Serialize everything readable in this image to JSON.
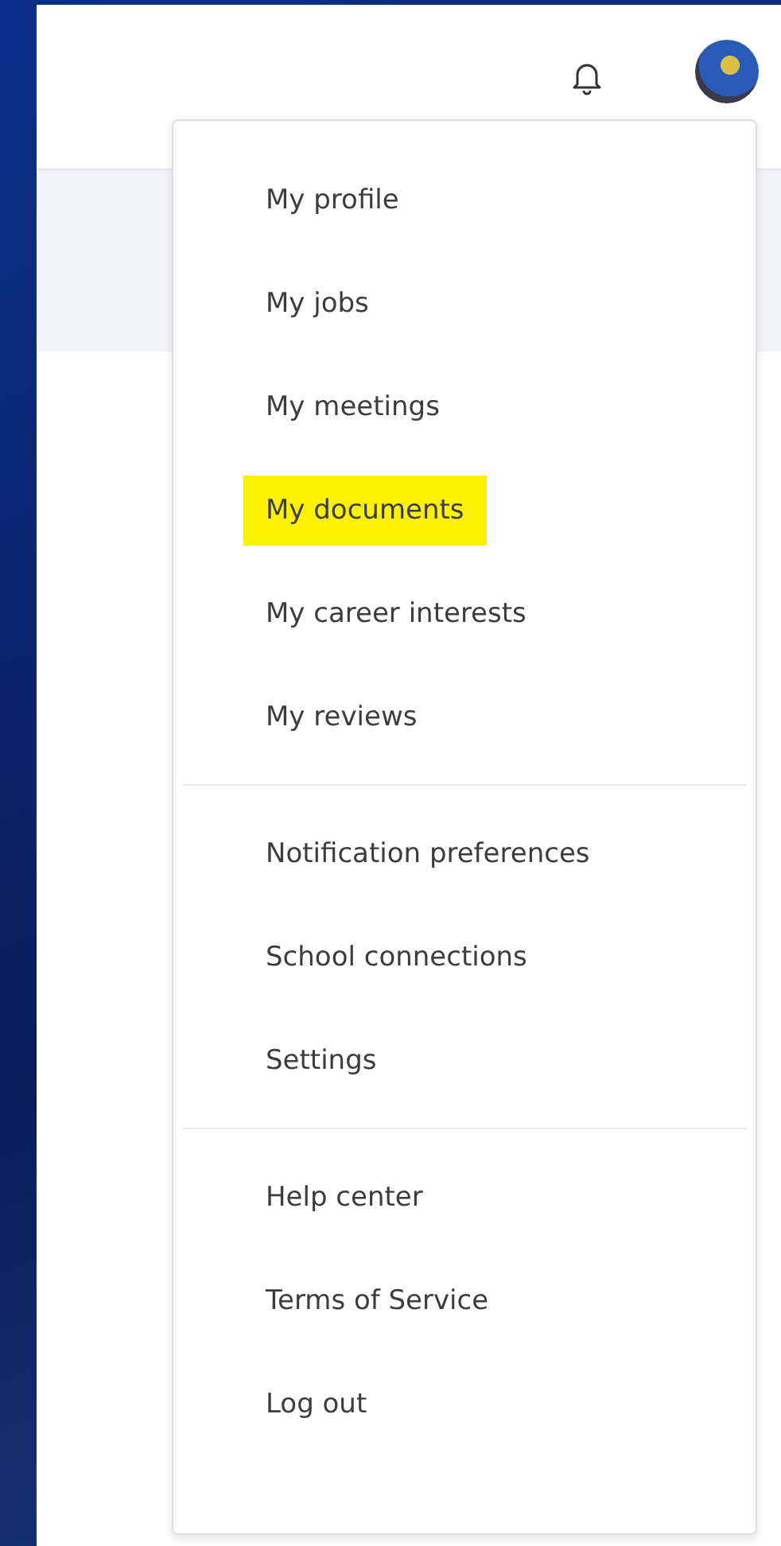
{
  "menu": {
    "groups": [
      {
        "items": [
          {
            "label": "My profile",
            "highlighted": false
          },
          {
            "label": "My jobs",
            "highlighted": false
          },
          {
            "label": "My meetings",
            "highlighted": false
          },
          {
            "label": "My documents",
            "highlighted": true
          },
          {
            "label": "My career interests",
            "highlighted": false
          },
          {
            "label": "My reviews",
            "highlighted": false
          }
        ]
      },
      {
        "items": [
          {
            "label": "Notification preferences",
            "highlighted": false
          },
          {
            "label": "School connections",
            "highlighted": false
          },
          {
            "label": "Settings",
            "highlighted": false
          }
        ]
      },
      {
        "items": [
          {
            "label": "Help center",
            "highlighted": false
          },
          {
            "label": "Terms of Service",
            "highlighted": false
          },
          {
            "label": "Log out",
            "highlighted": false
          }
        ]
      }
    ]
  }
}
